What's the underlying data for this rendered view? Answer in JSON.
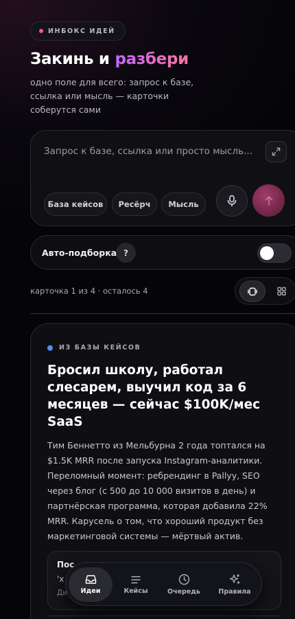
{
  "header": {
    "badge": "ИНБОКС ИДЕЙ",
    "title_main": "Закинь и ",
    "title_accent": "разбери",
    "subtitle": "одно поле для всего: запрос к базе, ссылка или мысль — карточки соберутся сами"
  },
  "composer": {
    "placeholder": "Запрос к базе, ссылка или просто мысль...",
    "chips": [
      "База кейсов",
      "Ресёрч",
      "Мысль"
    ]
  },
  "autopick": {
    "label": "Авто-подборка",
    "help": "?",
    "enabled": false
  },
  "feed": {
    "counter": "карточка 1 из 4 · осталось 4",
    "view_mode": "single"
  },
  "card": {
    "tag": "ИЗ БАЗЫ КЕЙСОВ",
    "title": "Бросил школу, работал слесарем, выучил код за 6 месяцев — сейчас $100K/мес SaaS",
    "body": "Тим Беннетто из Мельбурна 2 года топтался на $1.5K MRR после запуска Instagram-аналитики. Переломный момент: ребрендинг в Pallyy, SEO через блог (с 500 до 10 000 визитов в день) и партнёрская программа, которая добавила 22% MRR. Карусель о том, что хороший продукт без маркетинговой системы — мёртвый актив.",
    "sub_line1": "Пос",
    "sub_line2": "'х",
    "sub_line3": "Ди"
  },
  "tabbar": {
    "tabs": [
      {
        "label": "Идеи",
        "icon": "inbox-icon",
        "active": true
      },
      {
        "label": "Кейсы",
        "icon": "list-icon",
        "active": false
      },
      {
        "label": "Очередь",
        "icon": "clock-icon",
        "active": false
      },
      {
        "label": "Правила",
        "icon": "sparkle-icon",
        "active": false
      }
    ]
  },
  "colors": {
    "accent_pink": "#ff4fa0",
    "accent_gradient_start": "#c468ff",
    "accent_gradient_end": "#ff6fa1",
    "tag_blue": "#4a8ff0",
    "send_button": "#8a2f58"
  }
}
